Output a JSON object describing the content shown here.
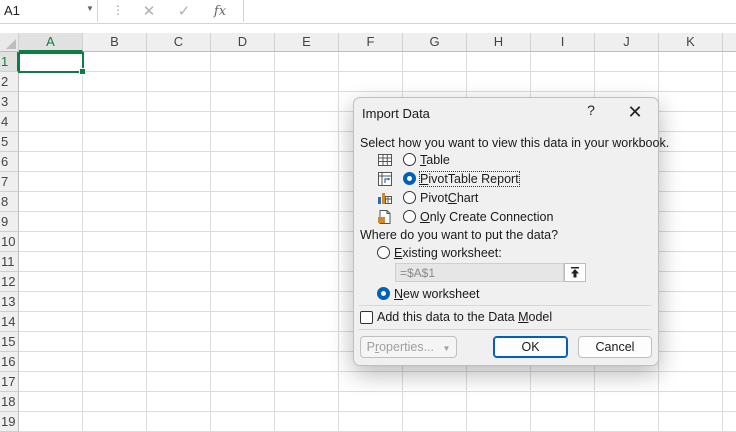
{
  "formula_bar": {
    "name_box": "A1",
    "cancel_symbol": "✕",
    "enter_symbol": "✓",
    "function_symbol": "fx",
    "formula": ""
  },
  "sheet": {
    "columns": [
      "A",
      "B",
      "C",
      "D",
      "E",
      "F",
      "G",
      "H",
      "I",
      "J",
      "K"
    ],
    "rows": [
      "1",
      "2",
      "3",
      "4",
      "5",
      "6",
      "7",
      "8",
      "9",
      "10",
      "11",
      "12",
      "13",
      "14",
      "15",
      "16",
      "17",
      "18",
      "19"
    ],
    "active_cell": "A1"
  },
  "dialog": {
    "title": "Import Data",
    "help_symbol": "?",
    "close_symbol": "✕",
    "view_prompt": "Select how you want to view this data in your workbook.",
    "view_options": [
      {
        "pre": "",
        "key": "T",
        "post": "able",
        "icon": "table-icon",
        "checked": false
      },
      {
        "pre": "",
        "key": "P",
        "post": "ivotTable Report",
        "icon": "pivottable-icon",
        "checked": true
      },
      {
        "pre": "Pivot",
        "key": "C",
        "post": "hart",
        "icon": "pivotchart-icon",
        "checked": false
      },
      {
        "pre": "",
        "key": "O",
        "post": "nly Create Connection",
        "icon": "connection-icon",
        "checked": false
      }
    ],
    "location_prompt": "Where do you want to put the data?",
    "existing_worksheet": {
      "pre": "",
      "key": "E",
      "post": "xisting worksheet:",
      "checked": false
    },
    "cell_reference": "=$A$1",
    "new_worksheet": {
      "pre": "",
      "key": "N",
      "post": "ew worksheet",
      "checked": true
    },
    "data_model": {
      "pre": "Add this data to the Data ",
      "key": "M",
      "post": "odel",
      "checked": false
    },
    "properties_button": {
      "pre": "P",
      "key": "r",
      "post": "operties..."
    },
    "ok_button": "OK",
    "cancel_button": "Cancel"
  },
  "colors": {
    "excel_green": "#107c41",
    "radio_blue": "#005fb8",
    "dialog_background": "#f0f0f0"
  }
}
